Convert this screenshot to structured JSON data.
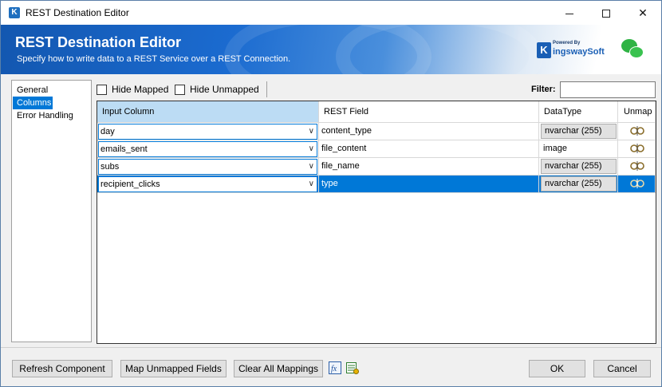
{
  "window": {
    "title": "REST Destination Editor",
    "icon": "kingswaysoft-k-icon"
  },
  "banner": {
    "title": "REST Destination Editor",
    "subtitle": "Specify how to write data to a REST Service over a REST Connection.",
    "brand_powered": "Powered By",
    "brand_k": "K",
    "brand_name": "ingswaySoft",
    "wechat_icon": "wechat-icon"
  },
  "nav": {
    "items": [
      {
        "label": "General",
        "selected": false
      },
      {
        "label": "Columns",
        "selected": true
      },
      {
        "label": "Error Handling",
        "selected": false
      }
    ]
  },
  "toolbar": {
    "hide_mapped": "Hide Mapped",
    "hide_unmapped": "Hide Unmapped",
    "filter_label": "Filter:",
    "filter_value": ""
  },
  "grid": {
    "headers": [
      "Input Column",
      "REST Field",
      "DataType",
      "Unmap"
    ],
    "rows": [
      {
        "input": "day",
        "field": "content_type",
        "datatype": "nvarchar (255)",
        "datatype_boxed": true
      },
      {
        "input": "emails_sent",
        "field": "file_content",
        "datatype": "image",
        "datatype_boxed": false
      },
      {
        "input": "subs",
        "field": "file_name",
        "datatype": "nvarchar (255)",
        "datatype_boxed": true
      },
      {
        "input": "recipient_clicks",
        "field": "type",
        "datatype": "nvarchar (255)",
        "datatype_boxed": true
      }
    ],
    "selected_row": 3
  },
  "buttons": {
    "refresh": "Refresh Component",
    "map_unmapped": "Map Unmapped Fields",
    "clear_all": "Clear All Mappings",
    "ok": "OK",
    "cancel": "Cancel"
  },
  "colors": {
    "accent": "#0078d7",
    "banner": "#1b6bd0",
    "header_active": "#bcdcf4"
  }
}
